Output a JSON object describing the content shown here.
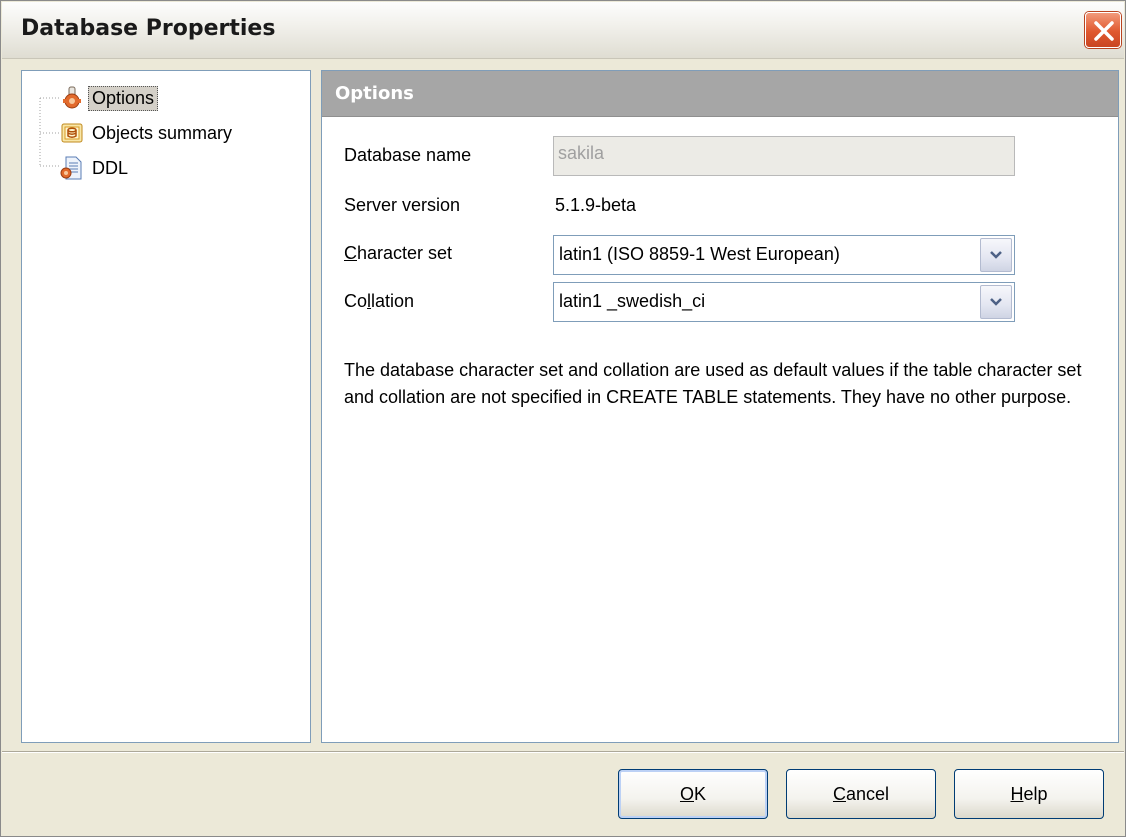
{
  "window": {
    "title": "Database Properties"
  },
  "tree": {
    "items": [
      {
        "label": "Options",
        "icon": "options-gear-icon",
        "selected": true
      },
      {
        "label": "Objects summary",
        "icon": "objects-summary-icon",
        "selected": false
      },
      {
        "label": "DDL",
        "icon": "ddl-document-icon",
        "selected": false
      }
    ]
  },
  "panel": {
    "header": "Options"
  },
  "form": {
    "database_name": {
      "label": "Database name",
      "value": "sakila"
    },
    "server_version": {
      "label": "Server version",
      "value": "5.1.9-beta"
    },
    "character_set": {
      "label_mnemonic": "C",
      "label_rest": "haracter set",
      "value": "latin1 (ISO 8859-1 West European)"
    },
    "collation": {
      "label_pre": "Co",
      "label_mnemonic": "l",
      "label_post": "lation",
      "value": "latin1 _swedish_ci"
    }
  },
  "description": "The database character set and collation are used as default values if the table character set and collation are not specified in CREATE TABLE statements. They have no other purpose.",
  "buttons": {
    "ok": {
      "mnemonic": "O",
      "rest": "K"
    },
    "cancel": {
      "mnemonic": "C",
      "rest": "ancel"
    },
    "help": {
      "mnemonic": "H",
      "rest": "elp"
    }
  },
  "colors": {
    "panel_header_bg": "#a6a6a6",
    "close_button": "#e0582f",
    "dialog_bg": "#ece9d8",
    "button_border": "#003c74"
  }
}
